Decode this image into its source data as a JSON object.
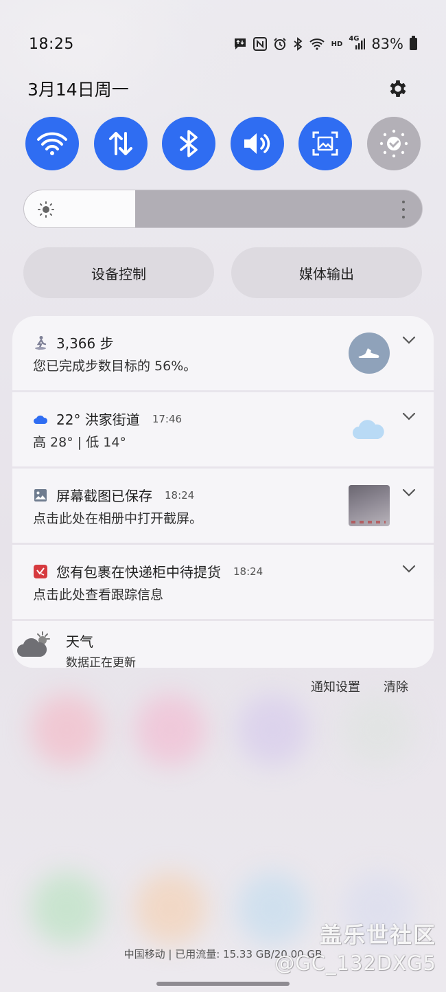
{
  "status_bar": {
    "time": "18:25",
    "icons": [
      "message-sync-icon",
      "nfc-icon",
      "alarm-icon",
      "bluetooth-icon",
      "wifi-icon",
      "hd-icon",
      "4g-signal-icon"
    ],
    "hd_label": "HD",
    "network_label": "4G",
    "battery": "83%"
  },
  "header": {
    "date": "3月14日周一"
  },
  "quick_toggles": [
    {
      "name": "wifi",
      "icon": "wifi-icon",
      "active": true
    },
    {
      "name": "mobile-data",
      "icon": "data-arrows-icon",
      "active": true
    },
    {
      "name": "bluetooth",
      "icon": "bluetooth-icon",
      "active": true
    },
    {
      "name": "sound",
      "icon": "volume-icon",
      "active": true
    },
    {
      "name": "screenshot",
      "icon": "screen-capture-icon",
      "active": true
    },
    {
      "name": "eye-comfort",
      "icon": "eye-comfort-icon",
      "active": false
    }
  ],
  "brightness": {
    "level": 0.28
  },
  "controls": {
    "device_control": "设备控制",
    "media_output": "媒体输出"
  },
  "notifications": [
    {
      "icon": "steps-icon",
      "title": "3,366 步",
      "time": "",
      "body": "您已完成步数目标的 56%。"
    },
    {
      "icon": "cloud-icon",
      "title": "22° 洪家街道",
      "time": "17:46",
      "body": "高 28° | 低 14°"
    },
    {
      "icon": "gallery-icon",
      "title": "屏幕截图已保存",
      "time": "18:24",
      "body": "点击此处在相册中打开截屏。"
    },
    {
      "icon": "package-icon",
      "title": "您有包裹在快递柜中待提货",
      "time": "18:24",
      "body": "点击此处查看跟踪信息"
    }
  ],
  "weather_widget": {
    "title": "天气",
    "body": "数据正在更新"
  },
  "notif_actions": {
    "settings": "通知设置",
    "clear": "清除"
  },
  "carrier": "中国移动 | 已用流量: 15.33 GB/20.00 GB",
  "watermark": {
    "line1": "盖乐世社区",
    "line2": "@GC_132DXG5"
  },
  "colors": {
    "accent": "#2f6df2",
    "toggle_off": "#b3b0b7",
    "card_bg": "#f6f5f8"
  }
}
